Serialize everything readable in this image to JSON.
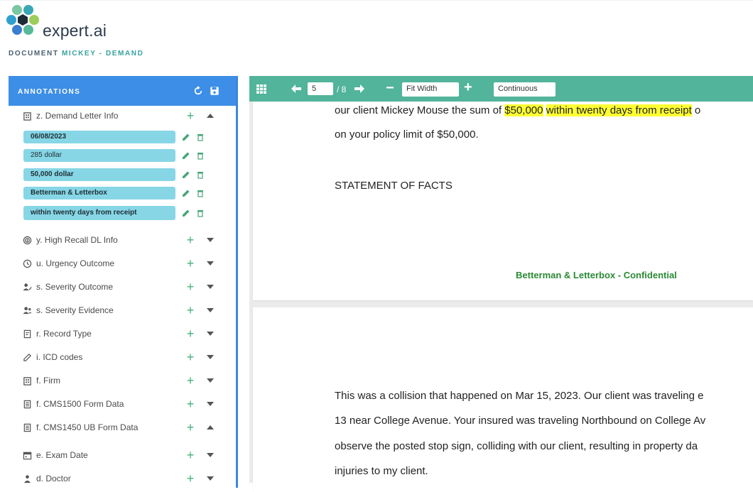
{
  "brand": {
    "name": "expert.ai"
  },
  "document": {
    "label": "DOCUMENT",
    "name": "MICKEY - DEMAND"
  },
  "annotations_panel": {
    "title": "ANNOTATIONS",
    "refresh_icon": "refresh-icon",
    "save_icon": "save-icon",
    "expanded_category": {
      "label": "z. Demand Letter Info",
      "icon": "building-icon",
      "tags": [
        {
          "text": "06/08/2023",
          "bold": true
        },
        {
          "text": "285 dollar",
          "bold": false
        },
        {
          "text": "50,000 dollar",
          "bold": true
        },
        {
          "text": "Betterman & Letterbox",
          "bold": true
        },
        {
          "text": "within twenty days from receipt",
          "bold": true
        }
      ]
    },
    "categories": [
      {
        "label": "y. High Recall DL Info",
        "icon": "fingerprint-icon",
        "state": "collapsed"
      },
      {
        "label": "u. Urgency Outcome",
        "icon": "clock-icon",
        "state": "collapsed"
      },
      {
        "label": "s. Severity Outcome",
        "icon": "user-edit-icon",
        "state": "collapsed"
      },
      {
        "label": "s. Severity Evidence",
        "icon": "user-group-icon",
        "state": "collapsed"
      },
      {
        "label": "r. Record Type",
        "icon": "document-icon",
        "state": "collapsed"
      },
      {
        "label": "i. ICD codes",
        "icon": "pencil-icon",
        "state": "collapsed"
      },
      {
        "label": "f. Firm",
        "icon": "building-icon",
        "state": "collapsed"
      },
      {
        "label": "f. CMS1500 Form Data",
        "icon": "form-icon",
        "state": "collapsed"
      },
      {
        "label": "f. CMS1450 UB Form Data",
        "icon": "form-icon",
        "state": "expanded"
      },
      {
        "label": "e. Exam Date",
        "icon": "calendar-icon",
        "state": "collapsed"
      },
      {
        "label": "d. Doctor",
        "icon": "doctor-icon",
        "state": "collapsed"
      }
    ]
  },
  "toolbar": {
    "page_current": "5",
    "page_total": "/ 8",
    "zoom": "Fit Width",
    "scroll_mode": "Continuous"
  },
  "page_a": {
    "line1_pre": "our client Mickey Mouse the sum of ",
    "line1_hl1": "$50,000",
    "line1_hl2": "within twenty days from receipt",
    "line1_post": " o",
    "line2": "on your policy limit of $50,000.",
    "heading": "STATEMENT OF FACTS",
    "footer": "Betterman & Letterbox - Confidential"
  },
  "page_b": {
    "line1": "This was a collision that happened on Mar 15, 2023. Our client was traveling e",
    "line2": "13 near College Avenue. Your insured was traveling Northbound on College Av",
    "line3": "observe the posted stop sign, colliding with our client, resulting in property da",
    "line4": "injuries to my client."
  },
  "colors": {
    "panel_header": "#3d8ee6",
    "toolbar": "#52b49a",
    "tag_fill": "#86d6e6",
    "highlight": "#ffff33",
    "footer_text": "#2a8a35",
    "add_icon": "#47b07c"
  }
}
